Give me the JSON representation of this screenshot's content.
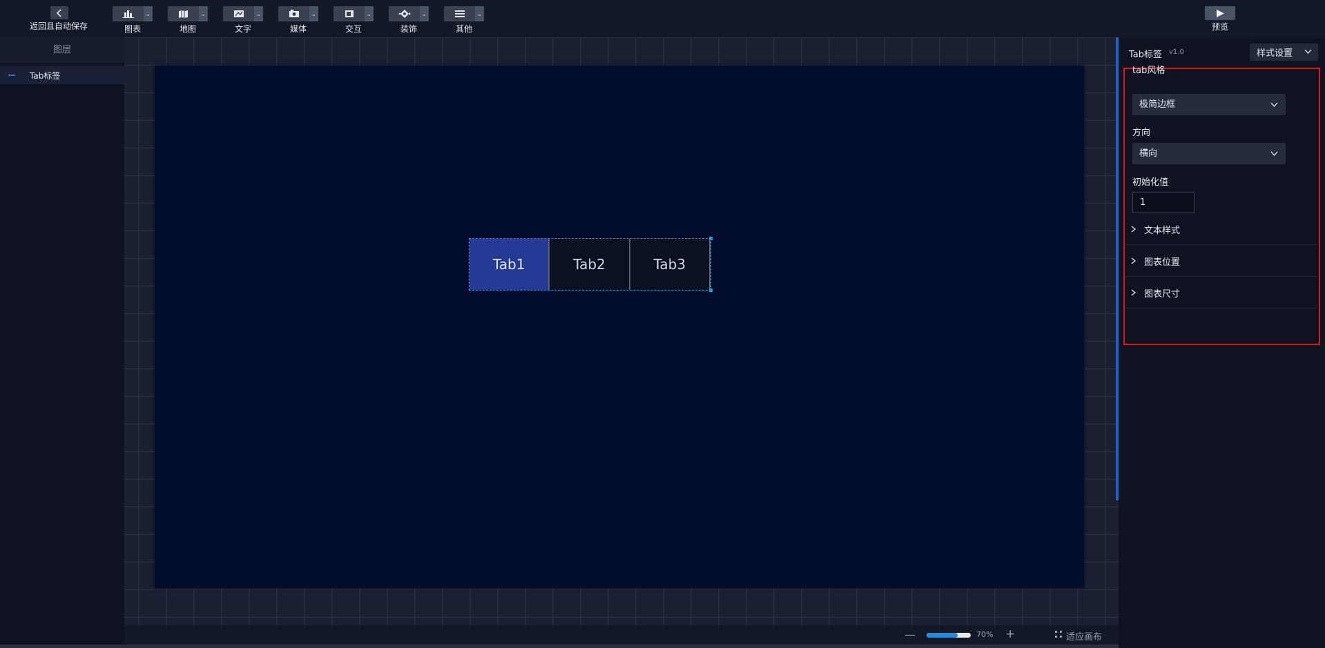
{
  "toolbar": {
    "back_label": "返回且自动保存",
    "tools": [
      {
        "label": "图表",
        "icon": "bar-chart-icon"
      },
      {
        "label": "地图",
        "icon": "map-icon"
      },
      {
        "label": "文字",
        "icon": "text-icon"
      },
      {
        "label": "媒体",
        "icon": "media-icon"
      },
      {
        "label": "交互",
        "icon": "interaction-icon"
      },
      {
        "label": "装饰",
        "icon": "decoration-icon"
      },
      {
        "label": "其他",
        "icon": "other-icon"
      }
    ],
    "preview_label": "预览"
  },
  "layers": {
    "title": "图层",
    "items": [
      {
        "label": "Tab标签"
      }
    ]
  },
  "canvas": {
    "tabs": [
      "Tab1",
      "Tab2",
      "Tab3"
    ],
    "active_tab_index": 0,
    "stage_color": "#020c2c",
    "active_tab_color": "#243a95"
  },
  "zoom": {
    "minus": "—",
    "value_label": "70%",
    "value_fraction": 0.7,
    "plus": "+",
    "fit_label": "适应画布"
  },
  "panel": {
    "title": "Tab标签",
    "version": "v1.0",
    "style_settings_label": "样式设置",
    "tab_style": {
      "label": "tab风格",
      "value": "极简边框"
    },
    "direction": {
      "label": "方向",
      "value": "横向"
    },
    "initial_value": {
      "label": "初始化值",
      "value": "1"
    },
    "sections": [
      "文本样式",
      "图表位置",
      "图表尺寸"
    ],
    "highlight_color": "#e0151b"
  }
}
